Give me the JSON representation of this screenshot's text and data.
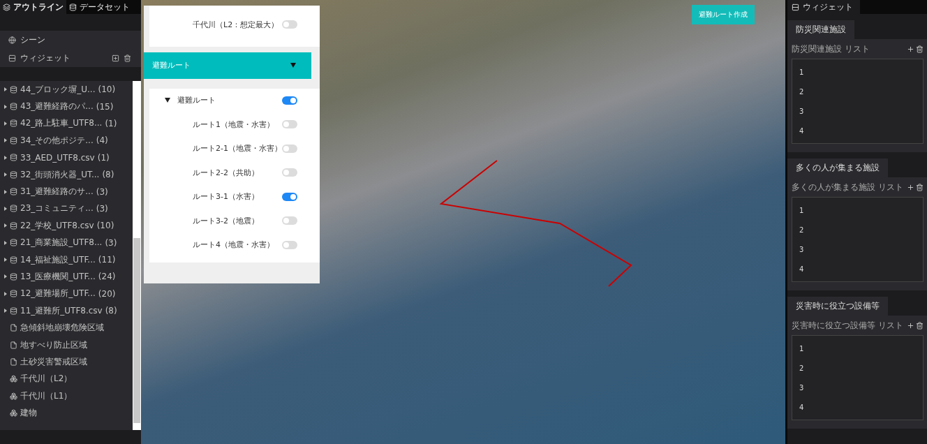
{
  "top_tabs": [
    {
      "label": "アウトライン",
      "selected": true
    },
    {
      "label": "データセット",
      "selected": false
    }
  ],
  "outline": {
    "scene": "シーン",
    "widget": "ウィジェット",
    "datasets": [
      {
        "name": "44_ブロック塀_U...",
        "count": "(10)"
      },
      {
        "name": "43_避難経路のパ...",
        "count": "(15)"
      },
      {
        "name": "42_路上駐車_UTF8...",
        "count": "(1)"
      },
      {
        "name": "34_その他ポジテ...",
        "count": "(4)"
      },
      {
        "name": "33_AED_UTF8.csv",
        "count": "(1)"
      },
      {
        "name": "32_街頭消火器_UT...",
        "count": "(8)"
      },
      {
        "name": "31_避難経路のサ...",
        "count": "(3)"
      },
      {
        "name": "23_コミュニティ...",
        "count": "(3)"
      },
      {
        "name": "22_学校_UTF8.csv",
        "count": "(10)"
      },
      {
        "name": "21_商業施設_UTF8...",
        "count": "(3)"
      },
      {
        "name": "14_福祉施設_UTF...",
        "count": "(11)"
      },
      {
        "name": "13_医療機関_UTF...",
        "count": "(24)"
      },
      {
        "name": "12_避難場所_UTF...",
        "count": "(20)"
      },
      {
        "name": "11_避難所_UTF8.csv",
        "count": "(8)"
      }
    ],
    "layers": [
      {
        "kind": "file",
        "label": "急傾斜地崩壊危険区域"
      },
      {
        "kind": "file",
        "label": "地すべり防止区域"
      },
      {
        "kind": "file",
        "label": "土砂災害警戒区域"
      },
      {
        "kind": "model",
        "label": "千代川（L2）"
      },
      {
        "kind": "model",
        "label": "千代川（L1）"
      },
      {
        "kind": "model",
        "label": "建物"
      }
    ]
  },
  "layer_panel": {
    "flood_item": {
      "label": "千代川（L2：想定最大）",
      "on": false
    },
    "section": {
      "title": "避難ルート",
      "expanded": true
    },
    "group": {
      "label": "避難ルート",
      "on": true,
      "expanded": true,
      "children": [
        {
          "label": "ルート1（地震・水害）",
          "on": false
        },
        {
          "label": "ルート2-1（地震・水害）",
          "on": false
        },
        {
          "label": "ルート2-2（共助）",
          "on": false
        },
        {
          "label": "ルート3-1（水害）",
          "on": true
        },
        {
          "label": "ルート3-2（地震）",
          "on": false
        },
        {
          "label": "ルート4（地震・水害）",
          "on": false
        }
      ]
    }
  },
  "map_button": "避難ルート作成",
  "widget_panel": {
    "title": "ウィジェット",
    "widgets": [
      {
        "title": "防災関連施設",
        "list_title": "防災関連施設 リスト",
        "items": [
          "1",
          "2",
          "3",
          "4"
        ]
      },
      {
        "title": "多くの人が集まる施設",
        "list_title": "多くの人が集まる施設 リスト",
        "items": [
          "1",
          "2",
          "3",
          "4"
        ]
      },
      {
        "title": "災害時に役立つ設備等",
        "list_title": "災害時に役立つ設備等 リスト",
        "items": [
          "1",
          "2",
          "3",
          "4"
        ]
      }
    ]
  }
}
